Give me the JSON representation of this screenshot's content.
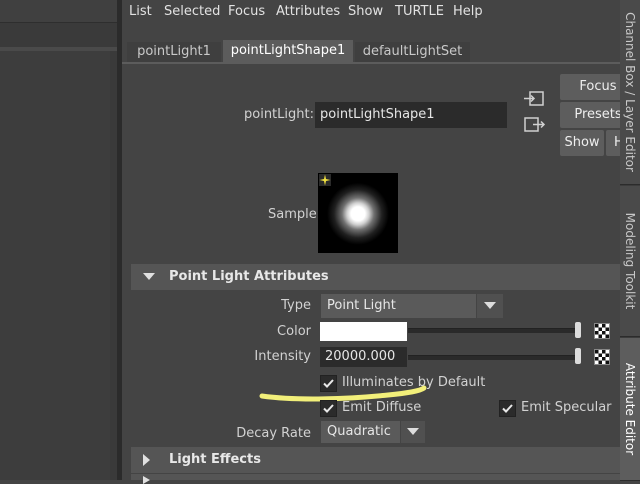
{
  "menubar": {
    "items": [
      "List",
      "Selected",
      "Focus",
      "Attributes",
      "Show",
      "TURTLE",
      "Help"
    ]
  },
  "tabs": [
    {
      "label": "pointLight1",
      "active": false
    },
    {
      "label": "pointLightShape1",
      "active": true
    },
    {
      "label": "defaultLightSet",
      "active": false
    }
  ],
  "side_tabs": {
    "channel_box": "Channel Box / Layer Editor",
    "modeling_toolkit": "Modeling Toolkit",
    "attribute_editor": "Attribute Editor"
  },
  "node": {
    "type_label": "pointLight:",
    "name_value": "pointLightShape1"
  },
  "buttons": {
    "focus": "Focus",
    "presets": "Presets",
    "show": "Show",
    "hide": "Hide"
  },
  "sample": {
    "label": "Sample"
  },
  "sections": {
    "point_light_attributes": "Point Light Attributes",
    "light_effects": "Light Effects"
  },
  "attributes": {
    "type_label": "Type",
    "type_value": "Point Light",
    "color_label": "Color",
    "color_value": "#ffffff",
    "intensity_label": "Intensity",
    "intensity_value": "20000.000",
    "illuminates_label": "Illuminates by Default",
    "illuminates_checked": true,
    "emit_diffuse_label": "Emit Diffuse",
    "emit_diffuse_checked": true,
    "emit_specular_label": "Emit Specular",
    "emit_specular_checked": true,
    "decay_label": "Decay Rate",
    "decay_value": "Quadratic"
  },
  "annotation": {
    "highlight_color": "#f2ef7a"
  },
  "colors": {
    "panel_bg": "#444444",
    "field_bg": "#2b2b2b",
    "section_bg": "#555555",
    "tab_active_bg": "#5c5c5c"
  }
}
